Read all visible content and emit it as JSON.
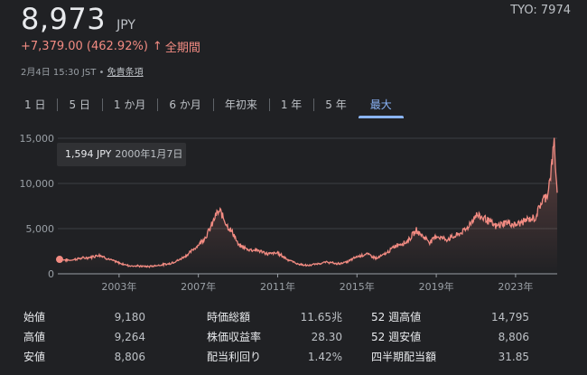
{
  "quote": {
    "price": "8,973",
    "currency": "JPY",
    "ticker": "TYO: 7974",
    "change": "+7,379.00 (462.92%)",
    "change_arrow": "↑",
    "change_period": "全期間",
    "timestamp": "2月4日 15:30 JST",
    "separator": " • ",
    "disclaimer": "免責条項",
    "accent_color": "#f28b82"
  },
  "tabs": [
    {
      "label": "1 日"
    },
    {
      "label": "5 日"
    },
    {
      "label": "1 か月"
    },
    {
      "label": "6 か月"
    },
    {
      "label": "年初来"
    },
    {
      "label": "1 年"
    },
    {
      "label": "5 年"
    },
    {
      "label": "最大",
      "active": true
    }
  ],
  "tooltip": {
    "price": "1,594 JPY",
    "date": "2000年1月7日"
  },
  "chart_data": {
    "type": "area",
    "x_labels": [
      "2003年",
      "2007年",
      "2011年",
      "2015年",
      "2019年",
      "2023年"
    ],
    "x_label_years": [
      2003,
      2007,
      2011,
      2015,
      2019,
      2023
    ],
    "y_ticks": [
      "0",
      "5,000",
      "10,000",
      "15,000"
    ],
    "y_tick_values": [
      0,
      5000,
      10000,
      15000
    ],
    "ylim": [
      0,
      15000
    ],
    "xlim": [
      2000.0,
      2025.1
    ],
    "grid": true,
    "color": "#f28b82",
    "series": [
      {
        "x": [
          2000.0,
          2000.5,
          2001.0,
          2001.5,
          2002.0,
          2002.5,
          2003.0,
          2003.5,
          2004.0,
          2004.5,
          2005.0,
          2005.5,
          2006.0,
          2006.5,
          2007.0,
          2007.4,
          2007.7,
          2007.9,
          2008.1,
          2008.5,
          2008.8,
          2009.0,
          2009.5,
          2010.0,
          2010.5,
          2011.0,
          2011.5,
          2012.0,
          2012.5,
          2013.0,
          2013.5,
          2014.0,
          2014.5,
          2015.0,
          2015.5,
          2016.0,
          2016.5,
          2017.0,
          2017.5,
          2018.0,
          2018.3,
          2018.7,
          2019.0,
          2019.5,
          2020.0,
          2020.5,
          2021.0,
          2021.5,
          2022.0,
          2022.5,
          2023.0,
          2023.5,
          2024.0,
          2024.3,
          2024.6,
          2024.8,
          2024.95,
          2025.1
        ],
        "y": [
          1594,
          1500,
          1700,
          1800,
          2100,
          1600,
          1200,
          900,
          850,
          800,
          950,
          1100,
          1500,
          2200,
          3200,
          4200,
          5500,
          6600,
          6900,
          5200,
          4300,
          3200,
          2700,
          2600,
          2200,
          2300,
          1600,
          1100,
          900,
          1100,
          1300,
          1100,
          1300,
          1900,
          2200,
          1700,
          2300,
          3200,
          3500,
          4800,
          4200,
          3500,
          4200,
          3800,
          4200,
          4900,
          6500,
          6100,
          5200,
          5700,
          5400,
          5900,
          6200,
          7900,
          8800,
          11500,
          14500,
          8973
        ]
      }
    ]
  },
  "stats": [
    {
      "l1": "始値",
      "v1": "9,180",
      "l2": "時価総額",
      "v2": "11.65兆",
      "l3": "52 週高値",
      "v3": "14,795"
    },
    {
      "l1": "高値",
      "v1": "9,264",
      "l2": "株価収益率",
      "v2": "28.30",
      "l3": "52 週安値",
      "v3": "8,806"
    },
    {
      "l1": "安値",
      "v1": "8,806",
      "l2": "配当利回り",
      "v2": "1.42%",
      "l3": "四半期配当額",
      "v3": "31.85"
    }
  ]
}
